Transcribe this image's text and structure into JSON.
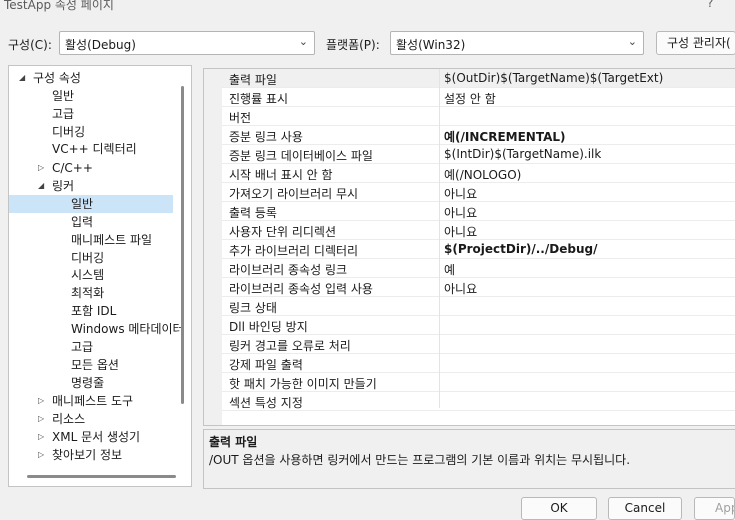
{
  "window": {
    "title": "TestApp 속성 페이지",
    "help": "?"
  },
  "config": {
    "label": "구성(C):",
    "value": "활성(Debug)"
  },
  "platform": {
    "label": "플랫폼(P):",
    "value": "활성(Win32)"
  },
  "config_manager": "구성 관리자(",
  "tree": [
    {
      "label": "구성 속성",
      "arrow": "open"
    },
    {
      "label": "일반"
    },
    {
      "label": "고급"
    },
    {
      "label": "디버깅"
    },
    {
      "label": "VC++ 디렉터리"
    },
    {
      "label": "C/C++",
      "arrow": "closed"
    },
    {
      "label": "링커",
      "arrow": "open"
    },
    {
      "label": "일반",
      "selected": true
    },
    {
      "label": "입력"
    },
    {
      "label": "매니페스트 파일"
    },
    {
      "label": "디버깅"
    },
    {
      "label": "시스템"
    },
    {
      "label": "최적화"
    },
    {
      "label": "포함 IDL"
    },
    {
      "label": "Windows 메타데이터"
    },
    {
      "label": "고급"
    },
    {
      "label": "모든 옵션"
    },
    {
      "label": "명령줄"
    },
    {
      "label": "매니페스트 도구",
      "arrow": "closed"
    },
    {
      "label": "리소스",
      "arrow": "closed"
    },
    {
      "label": "XML 문서 생성기",
      "arrow": "closed"
    },
    {
      "label": "찾아보기 정보",
      "arrow": "closed"
    }
  ],
  "properties": [
    {
      "name": "출력 파일",
      "value": "$(OutDir)$(TargetName)$(TargetExt)"
    },
    {
      "name": "진행률 표시",
      "value": "설정 안 함"
    },
    {
      "name": "버전",
      "value": ""
    },
    {
      "name": "증분 링크 사용",
      "value": "예(/INCREMENTAL)",
      "bold": true
    },
    {
      "name": "증분 링크 데이터베이스 파일",
      "value": "$(IntDir)$(TargetName).ilk"
    },
    {
      "name": "시작 배너 표시 안 함",
      "value": "예(/NOLOGO)"
    },
    {
      "name": "가져오기 라이브러리 무시",
      "value": "아니요"
    },
    {
      "name": "출력 등록",
      "value": "아니요"
    },
    {
      "name": "사용자 단위 리디렉션",
      "value": "아니요"
    },
    {
      "name": "추가 라이브러리 디렉터리",
      "value": "$(ProjectDir)/../Debug/",
      "bold": true
    },
    {
      "name": "라이브러리 종속성 링크",
      "value": "예"
    },
    {
      "name": "라이브러리 종속성 입력 사용",
      "value": "아니요"
    },
    {
      "name": "링크 상태",
      "value": ""
    },
    {
      "name": "Dll 바인딩 방지",
      "value": ""
    },
    {
      "name": "링커 경고를 오류로 처리",
      "value": ""
    },
    {
      "name": "강제 파일 출력",
      "value": ""
    },
    {
      "name": "핫 패치 가능한 이미지 만들기",
      "value": ""
    },
    {
      "name": "섹션 특성 지정",
      "value": ""
    }
  ],
  "description": {
    "title": "출력 파일",
    "text": "/OUT 옵션을 사용하면 링커에서 만드는 프로그램의 기본 이름과 위치는 무시됩니다."
  },
  "buttons": {
    "ok": "OK",
    "cancel": "Cancel",
    "apply": "Apply"
  }
}
